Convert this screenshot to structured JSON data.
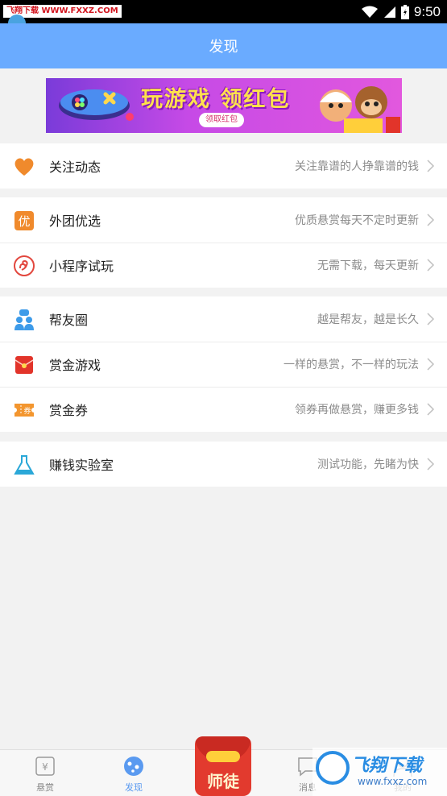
{
  "status_bar": {
    "tag": "飞翔下载 WWW.FXXZ.COM",
    "time": "9:50"
  },
  "header": {
    "title": "发现"
  },
  "banner": {
    "title": "玩游戏 领红包",
    "button": "领取红包"
  },
  "groups": [
    [
      {
        "icon": "heart-icon",
        "label": "关注动态",
        "desc": "关注靠谱的人挣靠谱的钱"
      }
    ],
    [
      {
        "icon": "you-badge-icon",
        "label": "外团优选",
        "desc": "优质悬赏每天不定时更新"
      },
      {
        "icon": "mini-program-icon",
        "label": "小程序试玩",
        "desc": "无需下载，每天更新"
      }
    ],
    [
      {
        "icon": "friends-icon",
        "label": "帮友圈",
        "desc": "越是帮友，越是长久"
      },
      {
        "icon": "red-envelope-icon",
        "label": "赏金游戏",
        "desc": "一样的悬赏，不一样的玩法"
      },
      {
        "icon": "coupon-icon",
        "label": "赏金券",
        "desc": "领券再做悬赏，赚更多钱"
      }
    ],
    [
      {
        "icon": "flask-icon",
        "label": "赚钱实验室",
        "desc": "测试功能，先睹为快"
      }
    ]
  ],
  "tabs": {
    "reward": "悬赏",
    "discover": "发现",
    "center": "师徒",
    "messages": "消息",
    "mine": "我的"
  },
  "watermark": {
    "brand": "飞翔下载",
    "url": "www.fxxz.com"
  },
  "colors": {
    "header": "#6aabff",
    "accent": "#5a9af0",
    "orange": "#f08a2c",
    "red": "#e23a2e"
  }
}
